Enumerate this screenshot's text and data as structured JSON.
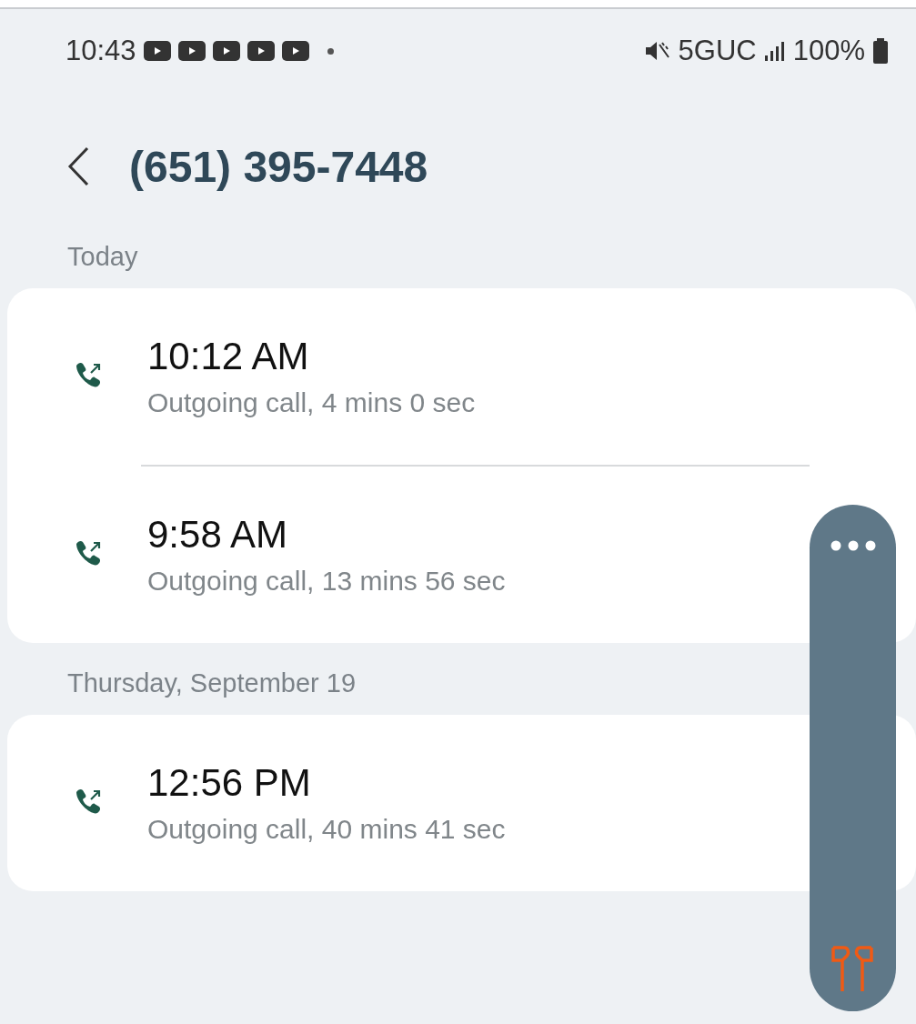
{
  "status_bar": {
    "time": "10:43",
    "notification_icons": [
      {
        "kind": "video"
      },
      {
        "kind": "video"
      },
      {
        "kind": "video"
      },
      {
        "kind": "video"
      },
      {
        "kind": "video"
      }
    ],
    "network": "5GUC",
    "battery": "100%"
  },
  "header": {
    "title": "(651) 395-7448"
  },
  "sections": [
    {
      "heading": "Today",
      "calls": [
        {
          "time": "10:12 AM",
          "detail": "Outgoing call, 4 mins 0 sec"
        },
        {
          "time": "9:58 AM",
          "detail": "Outgoing call, 13 mins 56 sec"
        }
      ]
    },
    {
      "heading": "Thursday, September 19",
      "calls": [
        {
          "time": "12:56 PM",
          "detail": "Outgoing call, 40 mins 41 sec"
        }
      ]
    }
  ]
}
